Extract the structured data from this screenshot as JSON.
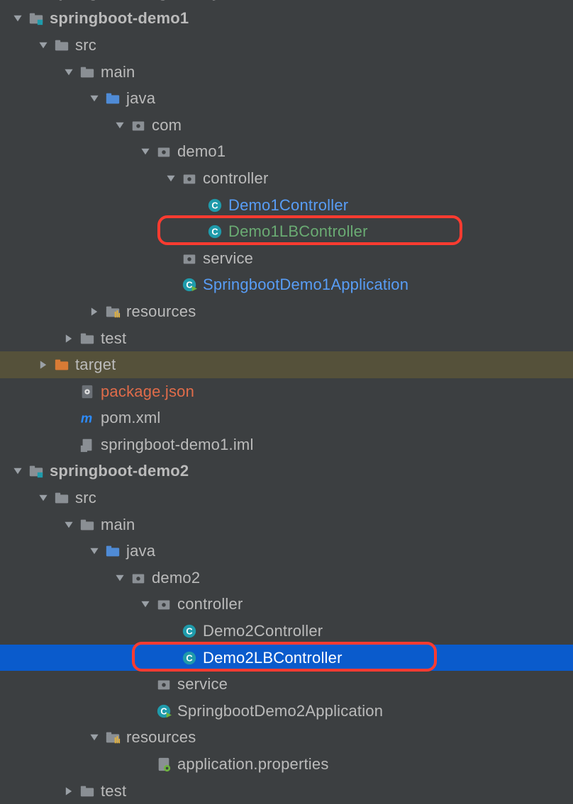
{
  "nodes": [
    {
      "indent": 1,
      "arrow": "expanded",
      "icon": "module-folder",
      "label": "spring_cloud_gateway",
      "labelClass": "bold clr-gray",
      "rowClass": "",
      "interactArrow": true
    },
    {
      "indent": 1,
      "arrow": "expanded",
      "icon": "module-folder",
      "label": "springboot-demo1",
      "labelClass": "bold clr-gray"
    },
    {
      "indent": 2,
      "arrow": "expanded",
      "icon": "folder-gray",
      "label": "src",
      "labelClass": "clr-gray"
    },
    {
      "indent": 3,
      "arrow": "expanded",
      "icon": "folder-gray",
      "label": "main",
      "labelClass": "clr-gray"
    },
    {
      "indent": 4,
      "arrow": "expanded",
      "icon": "folder-blue",
      "label": "java",
      "labelClass": "clr-gray"
    },
    {
      "indent": 5,
      "arrow": "expanded",
      "icon": "package",
      "label": "com",
      "labelClass": "clr-gray"
    },
    {
      "indent": 6,
      "arrow": "expanded",
      "icon": "package",
      "label": "demo1",
      "labelClass": "clr-gray"
    },
    {
      "indent": 7,
      "arrow": "expanded",
      "icon": "package",
      "label": "controller",
      "labelClass": "clr-gray"
    },
    {
      "indent": 8,
      "arrow": "none",
      "icon": "class",
      "label": "Demo1Controller",
      "labelClass": "clr-blue"
    },
    {
      "indent": 8,
      "arrow": "none",
      "icon": "class",
      "label": "Demo1LBController",
      "labelClass": "clr-green",
      "outline": true
    },
    {
      "indent": 7,
      "arrow": "none",
      "icon": "package",
      "label": "service",
      "labelClass": "clr-gray"
    },
    {
      "indent": 7,
      "arrow": "none",
      "icon": "class-run",
      "label": "SpringbootDemo1Application",
      "labelClass": "clr-blue"
    },
    {
      "indent": 4,
      "arrow": "collapsed",
      "icon": "resources",
      "label": "resources",
      "labelClass": "clr-gray"
    },
    {
      "indent": 3,
      "arrow": "collapsed",
      "icon": "folder-gray",
      "label": "test",
      "labelClass": "clr-gray"
    },
    {
      "indent": 2,
      "arrow": "collapsed",
      "icon": "folder-orange",
      "label": "target",
      "labelClass": "clr-gray",
      "rowClass": "highlight-target"
    },
    {
      "indent": 3,
      "arrow": "none",
      "icon": "json",
      "label": "package.json",
      "labelClass": "clr-orange",
      "noArrowSpace": false
    },
    {
      "indent": 3,
      "arrow": "none",
      "icon": "maven",
      "label": "pom.xml",
      "labelClass": "clr-gray"
    },
    {
      "indent": 3,
      "arrow": "none",
      "icon": "iml",
      "label": "springboot-demo1.iml",
      "labelClass": "clr-gray"
    },
    {
      "indent": 1,
      "arrow": "expanded",
      "icon": "module-folder",
      "label": "springboot-demo2",
      "labelClass": "bold clr-gray"
    },
    {
      "indent": 2,
      "arrow": "expanded",
      "icon": "folder-gray",
      "label": "src",
      "labelClass": "clr-gray"
    },
    {
      "indent": 3,
      "arrow": "expanded",
      "icon": "folder-gray",
      "label": "main",
      "labelClass": "clr-gray"
    },
    {
      "indent": 4,
      "arrow": "expanded",
      "icon": "folder-blue",
      "label": "java",
      "labelClass": "clr-gray"
    },
    {
      "indent": 5,
      "arrow": "expanded",
      "icon": "package",
      "label": "demo2",
      "labelClass": "clr-gray"
    },
    {
      "indent": 6,
      "arrow": "expanded",
      "icon": "package",
      "label": "controller",
      "labelClass": "clr-gray"
    },
    {
      "indent": 7,
      "arrow": "none",
      "icon": "class",
      "label": "Demo2Controller",
      "labelClass": "clr-gray"
    },
    {
      "indent": 7,
      "arrow": "none",
      "icon": "class",
      "label": "Demo2LBController",
      "labelClass": "clr-gray",
      "rowClass": "selected",
      "outline": true
    },
    {
      "indent": 6,
      "arrow": "none",
      "icon": "package",
      "label": "service",
      "labelClass": "clr-gray"
    },
    {
      "indent": 6,
      "arrow": "none",
      "icon": "class-run",
      "label": "SpringbootDemo2Application",
      "labelClass": "clr-gray"
    },
    {
      "indent": 4,
      "arrow": "expanded",
      "icon": "resources",
      "label": "resources",
      "labelClass": "clr-gray"
    },
    {
      "indent": 6,
      "arrow": "none",
      "icon": "props",
      "label": "application.properties",
      "labelClass": "clr-gray"
    },
    {
      "indent": 3,
      "arrow": "collapsed",
      "icon": "folder-gray",
      "label": "test",
      "labelClass": "clr-gray"
    }
  ],
  "icons": {
    "module-folder": "module-folder-icon",
    "folder-gray": "folder-icon",
    "folder-blue": "folder-source-icon",
    "folder-orange": "folder-excluded-icon",
    "package": "package-icon",
    "class": "class-icon",
    "class-run": "class-runnable-icon",
    "resources": "resources-folder-icon",
    "json": "json-file-icon",
    "maven": "maven-file-icon",
    "iml": "iml-file-icon",
    "props": "properties-file-icon"
  }
}
